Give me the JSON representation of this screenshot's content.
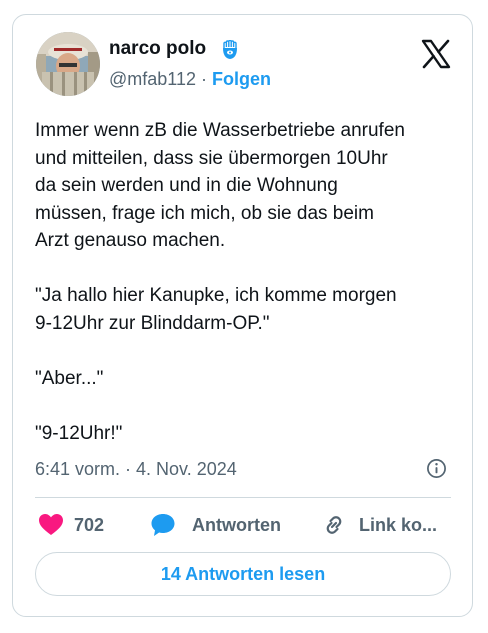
{
  "author": {
    "display_name": "narco polo",
    "handle": "@mfab112",
    "separator": "·",
    "follow_label": "Folgen"
  },
  "tweet": {
    "text": "Immer wenn zB die Wasserbetriebe anrufen\nund mitteilen, dass sie übermorgen 10Uhr\nda sein werden und in die Wohnung\nmüssen, frage ich mich, ob sie das beim\nArzt genauso machen.\n\n\"Ja hallo hier Kanupke, ich komme morgen\n9-12Uhr zur Blinddarm-OP.\"\n\n\"Aber...\"\n\n\"9-12Uhr!\"",
    "timestamp": "6:41 vorm. · 4. Nov. 2024"
  },
  "actions": {
    "likes_count": "702",
    "reply_label": "Antworten",
    "link_label": "Link ko..."
  },
  "read_replies_label": "14 Antworten lesen",
  "colors": {
    "accent": "#1d9bf0",
    "like": "#f91880",
    "text": "#0f1419",
    "muted": "#536471",
    "border": "#cfd9de"
  },
  "icons": {
    "verified": "hamsa-badge-icon",
    "platform": "x-logo-icon",
    "info": "info-icon",
    "like": "heart-icon",
    "reply": "speech-bubble-icon",
    "link": "link-icon"
  }
}
